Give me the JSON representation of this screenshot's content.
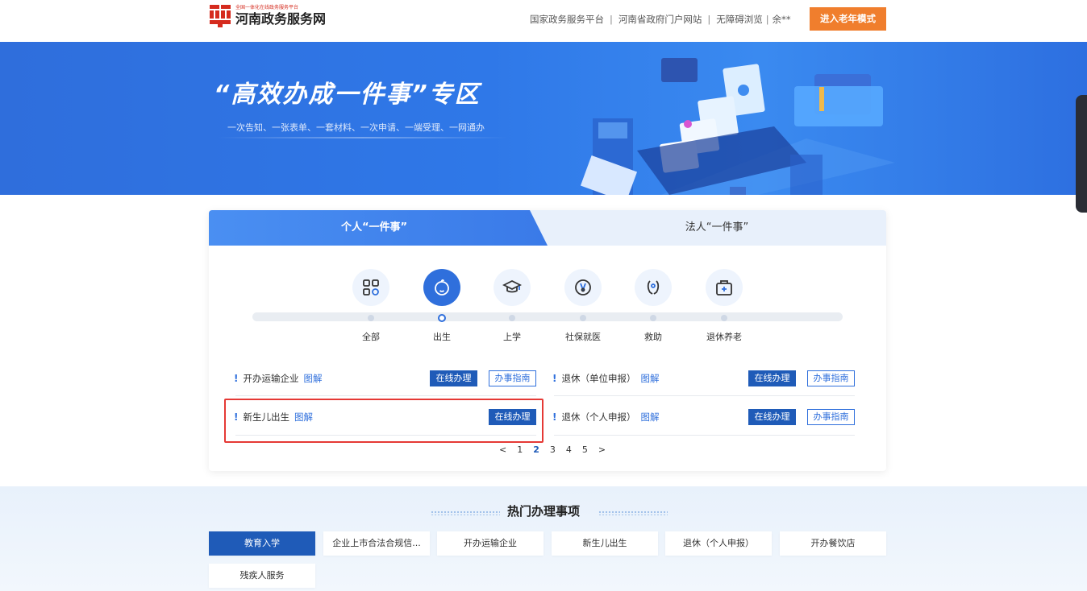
{
  "header": {
    "logo_small": "全国一体化在线政务服务平台",
    "logo_title": "河南政务服务网",
    "links": [
      "国家政务服务平台",
      "河南省政府门户网站",
      "无障碍浏览",
      "余**"
    ],
    "elder_mode": "进入老年模式"
  },
  "banner": {
    "title": "“高效办成一件事”专区",
    "subtitle": "一次告知、一张表单、一套材料、一次申请、一端受理、一网通办"
  },
  "tabs": {
    "personal": "个人“一件事”",
    "legal": "法人“一件事”"
  },
  "categories": [
    {
      "label": "全部",
      "icon": "grid-icon"
    },
    {
      "label": "出生",
      "icon": "baby-icon",
      "active": true
    },
    {
      "label": "上学",
      "icon": "graduation-cap-icon"
    },
    {
      "label": "社保就医",
      "icon": "medical-icon"
    },
    {
      "label": "救助",
      "icon": "help-hands-icon"
    },
    {
      "label": "退休养老",
      "icon": "medical-kit-icon"
    }
  ],
  "items": [
    {
      "name": "开办运输企业",
      "diagram": "图解",
      "online": "在线办理",
      "guide": "办事指南"
    },
    {
      "name": "退休（单位申报）",
      "diagram": "图解",
      "online": "在线办理",
      "guide": "办事指南"
    },
    {
      "name": "新生儿出生",
      "diagram": "图解",
      "online": "在线办理"
    },
    {
      "name": "退休（个人申报）",
      "diagram": "图解",
      "online": "在线办理",
      "guide": "办事指南"
    }
  ],
  "pager": {
    "prev": "<",
    "pages": [
      "1",
      "2",
      "3",
      "4",
      "5"
    ],
    "current": "2",
    "next": ">"
  },
  "hot": {
    "title": "热门办理事项",
    "items": [
      "教育入学",
      "企业上市合法合规信...",
      "开办运输企业",
      "新生儿出生",
      "退休（个人申报）",
      "开办餐饮店",
      "残疾人服务"
    ],
    "active": "教育入学"
  },
  "colors": {
    "primary": "#1f5bb8",
    "accent": "#2f6fdc",
    "elder": "#f07e2d",
    "highlight": "#e53935"
  }
}
